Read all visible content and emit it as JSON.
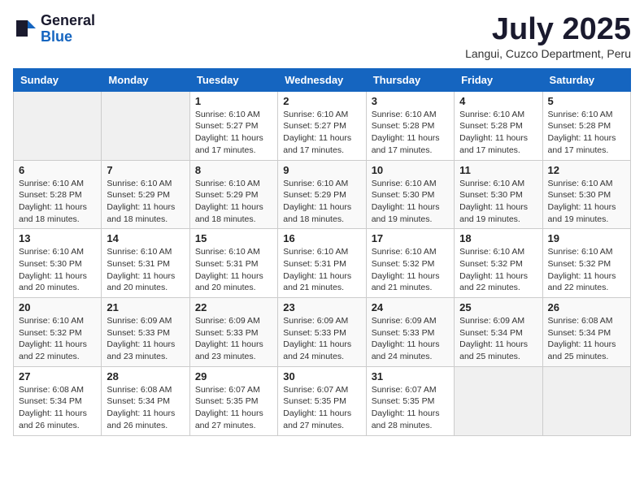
{
  "logo": {
    "general": "General",
    "blue": "Blue"
  },
  "header": {
    "month_title": "July 2025",
    "location": "Langui, Cuzco Department, Peru"
  },
  "days_of_week": [
    "Sunday",
    "Monday",
    "Tuesday",
    "Wednesday",
    "Thursday",
    "Friday",
    "Saturday"
  ],
  "weeks": [
    [
      {
        "day": "",
        "sunrise": "",
        "sunset": "",
        "daylight": ""
      },
      {
        "day": "",
        "sunrise": "",
        "sunset": "",
        "daylight": ""
      },
      {
        "day": "1",
        "sunrise": "Sunrise: 6:10 AM",
        "sunset": "Sunset: 5:27 PM",
        "daylight": "Daylight: 11 hours and 17 minutes."
      },
      {
        "day": "2",
        "sunrise": "Sunrise: 6:10 AM",
        "sunset": "Sunset: 5:27 PM",
        "daylight": "Daylight: 11 hours and 17 minutes."
      },
      {
        "day": "3",
        "sunrise": "Sunrise: 6:10 AM",
        "sunset": "Sunset: 5:28 PM",
        "daylight": "Daylight: 11 hours and 17 minutes."
      },
      {
        "day": "4",
        "sunrise": "Sunrise: 6:10 AM",
        "sunset": "Sunset: 5:28 PM",
        "daylight": "Daylight: 11 hours and 17 minutes."
      },
      {
        "day": "5",
        "sunrise": "Sunrise: 6:10 AM",
        "sunset": "Sunset: 5:28 PM",
        "daylight": "Daylight: 11 hours and 17 minutes."
      }
    ],
    [
      {
        "day": "6",
        "sunrise": "Sunrise: 6:10 AM",
        "sunset": "Sunset: 5:28 PM",
        "daylight": "Daylight: 11 hours and 18 minutes."
      },
      {
        "day": "7",
        "sunrise": "Sunrise: 6:10 AM",
        "sunset": "Sunset: 5:29 PM",
        "daylight": "Daylight: 11 hours and 18 minutes."
      },
      {
        "day": "8",
        "sunrise": "Sunrise: 6:10 AM",
        "sunset": "Sunset: 5:29 PM",
        "daylight": "Daylight: 11 hours and 18 minutes."
      },
      {
        "day": "9",
        "sunrise": "Sunrise: 6:10 AM",
        "sunset": "Sunset: 5:29 PM",
        "daylight": "Daylight: 11 hours and 18 minutes."
      },
      {
        "day": "10",
        "sunrise": "Sunrise: 6:10 AM",
        "sunset": "Sunset: 5:30 PM",
        "daylight": "Daylight: 11 hours and 19 minutes."
      },
      {
        "day": "11",
        "sunrise": "Sunrise: 6:10 AM",
        "sunset": "Sunset: 5:30 PM",
        "daylight": "Daylight: 11 hours and 19 minutes."
      },
      {
        "day": "12",
        "sunrise": "Sunrise: 6:10 AM",
        "sunset": "Sunset: 5:30 PM",
        "daylight": "Daylight: 11 hours and 19 minutes."
      }
    ],
    [
      {
        "day": "13",
        "sunrise": "Sunrise: 6:10 AM",
        "sunset": "Sunset: 5:30 PM",
        "daylight": "Daylight: 11 hours and 20 minutes."
      },
      {
        "day": "14",
        "sunrise": "Sunrise: 6:10 AM",
        "sunset": "Sunset: 5:31 PM",
        "daylight": "Daylight: 11 hours and 20 minutes."
      },
      {
        "day": "15",
        "sunrise": "Sunrise: 6:10 AM",
        "sunset": "Sunset: 5:31 PM",
        "daylight": "Daylight: 11 hours and 20 minutes."
      },
      {
        "day": "16",
        "sunrise": "Sunrise: 6:10 AM",
        "sunset": "Sunset: 5:31 PM",
        "daylight": "Daylight: 11 hours and 21 minutes."
      },
      {
        "day": "17",
        "sunrise": "Sunrise: 6:10 AM",
        "sunset": "Sunset: 5:32 PM",
        "daylight": "Daylight: 11 hours and 21 minutes."
      },
      {
        "day": "18",
        "sunrise": "Sunrise: 6:10 AM",
        "sunset": "Sunset: 5:32 PM",
        "daylight": "Daylight: 11 hours and 22 minutes."
      },
      {
        "day": "19",
        "sunrise": "Sunrise: 6:10 AM",
        "sunset": "Sunset: 5:32 PM",
        "daylight": "Daylight: 11 hours and 22 minutes."
      }
    ],
    [
      {
        "day": "20",
        "sunrise": "Sunrise: 6:10 AM",
        "sunset": "Sunset: 5:32 PM",
        "daylight": "Daylight: 11 hours and 22 minutes."
      },
      {
        "day": "21",
        "sunrise": "Sunrise: 6:09 AM",
        "sunset": "Sunset: 5:33 PM",
        "daylight": "Daylight: 11 hours and 23 minutes."
      },
      {
        "day": "22",
        "sunrise": "Sunrise: 6:09 AM",
        "sunset": "Sunset: 5:33 PM",
        "daylight": "Daylight: 11 hours and 23 minutes."
      },
      {
        "day": "23",
        "sunrise": "Sunrise: 6:09 AM",
        "sunset": "Sunset: 5:33 PM",
        "daylight": "Daylight: 11 hours and 24 minutes."
      },
      {
        "day": "24",
        "sunrise": "Sunrise: 6:09 AM",
        "sunset": "Sunset: 5:33 PM",
        "daylight": "Daylight: 11 hours and 24 minutes."
      },
      {
        "day": "25",
        "sunrise": "Sunrise: 6:09 AM",
        "sunset": "Sunset: 5:34 PM",
        "daylight": "Daylight: 11 hours and 25 minutes."
      },
      {
        "day": "26",
        "sunrise": "Sunrise: 6:08 AM",
        "sunset": "Sunset: 5:34 PM",
        "daylight": "Daylight: 11 hours and 25 minutes."
      }
    ],
    [
      {
        "day": "27",
        "sunrise": "Sunrise: 6:08 AM",
        "sunset": "Sunset: 5:34 PM",
        "daylight": "Daylight: 11 hours and 26 minutes."
      },
      {
        "day": "28",
        "sunrise": "Sunrise: 6:08 AM",
        "sunset": "Sunset: 5:34 PM",
        "daylight": "Daylight: 11 hours and 26 minutes."
      },
      {
        "day": "29",
        "sunrise": "Sunrise: 6:07 AM",
        "sunset": "Sunset: 5:35 PM",
        "daylight": "Daylight: 11 hours and 27 minutes."
      },
      {
        "day": "30",
        "sunrise": "Sunrise: 6:07 AM",
        "sunset": "Sunset: 5:35 PM",
        "daylight": "Daylight: 11 hours and 27 minutes."
      },
      {
        "day": "31",
        "sunrise": "Sunrise: 6:07 AM",
        "sunset": "Sunset: 5:35 PM",
        "daylight": "Daylight: 11 hours and 28 minutes."
      },
      {
        "day": "",
        "sunrise": "",
        "sunset": "",
        "daylight": ""
      },
      {
        "day": "",
        "sunrise": "",
        "sunset": "",
        "daylight": ""
      }
    ]
  ]
}
